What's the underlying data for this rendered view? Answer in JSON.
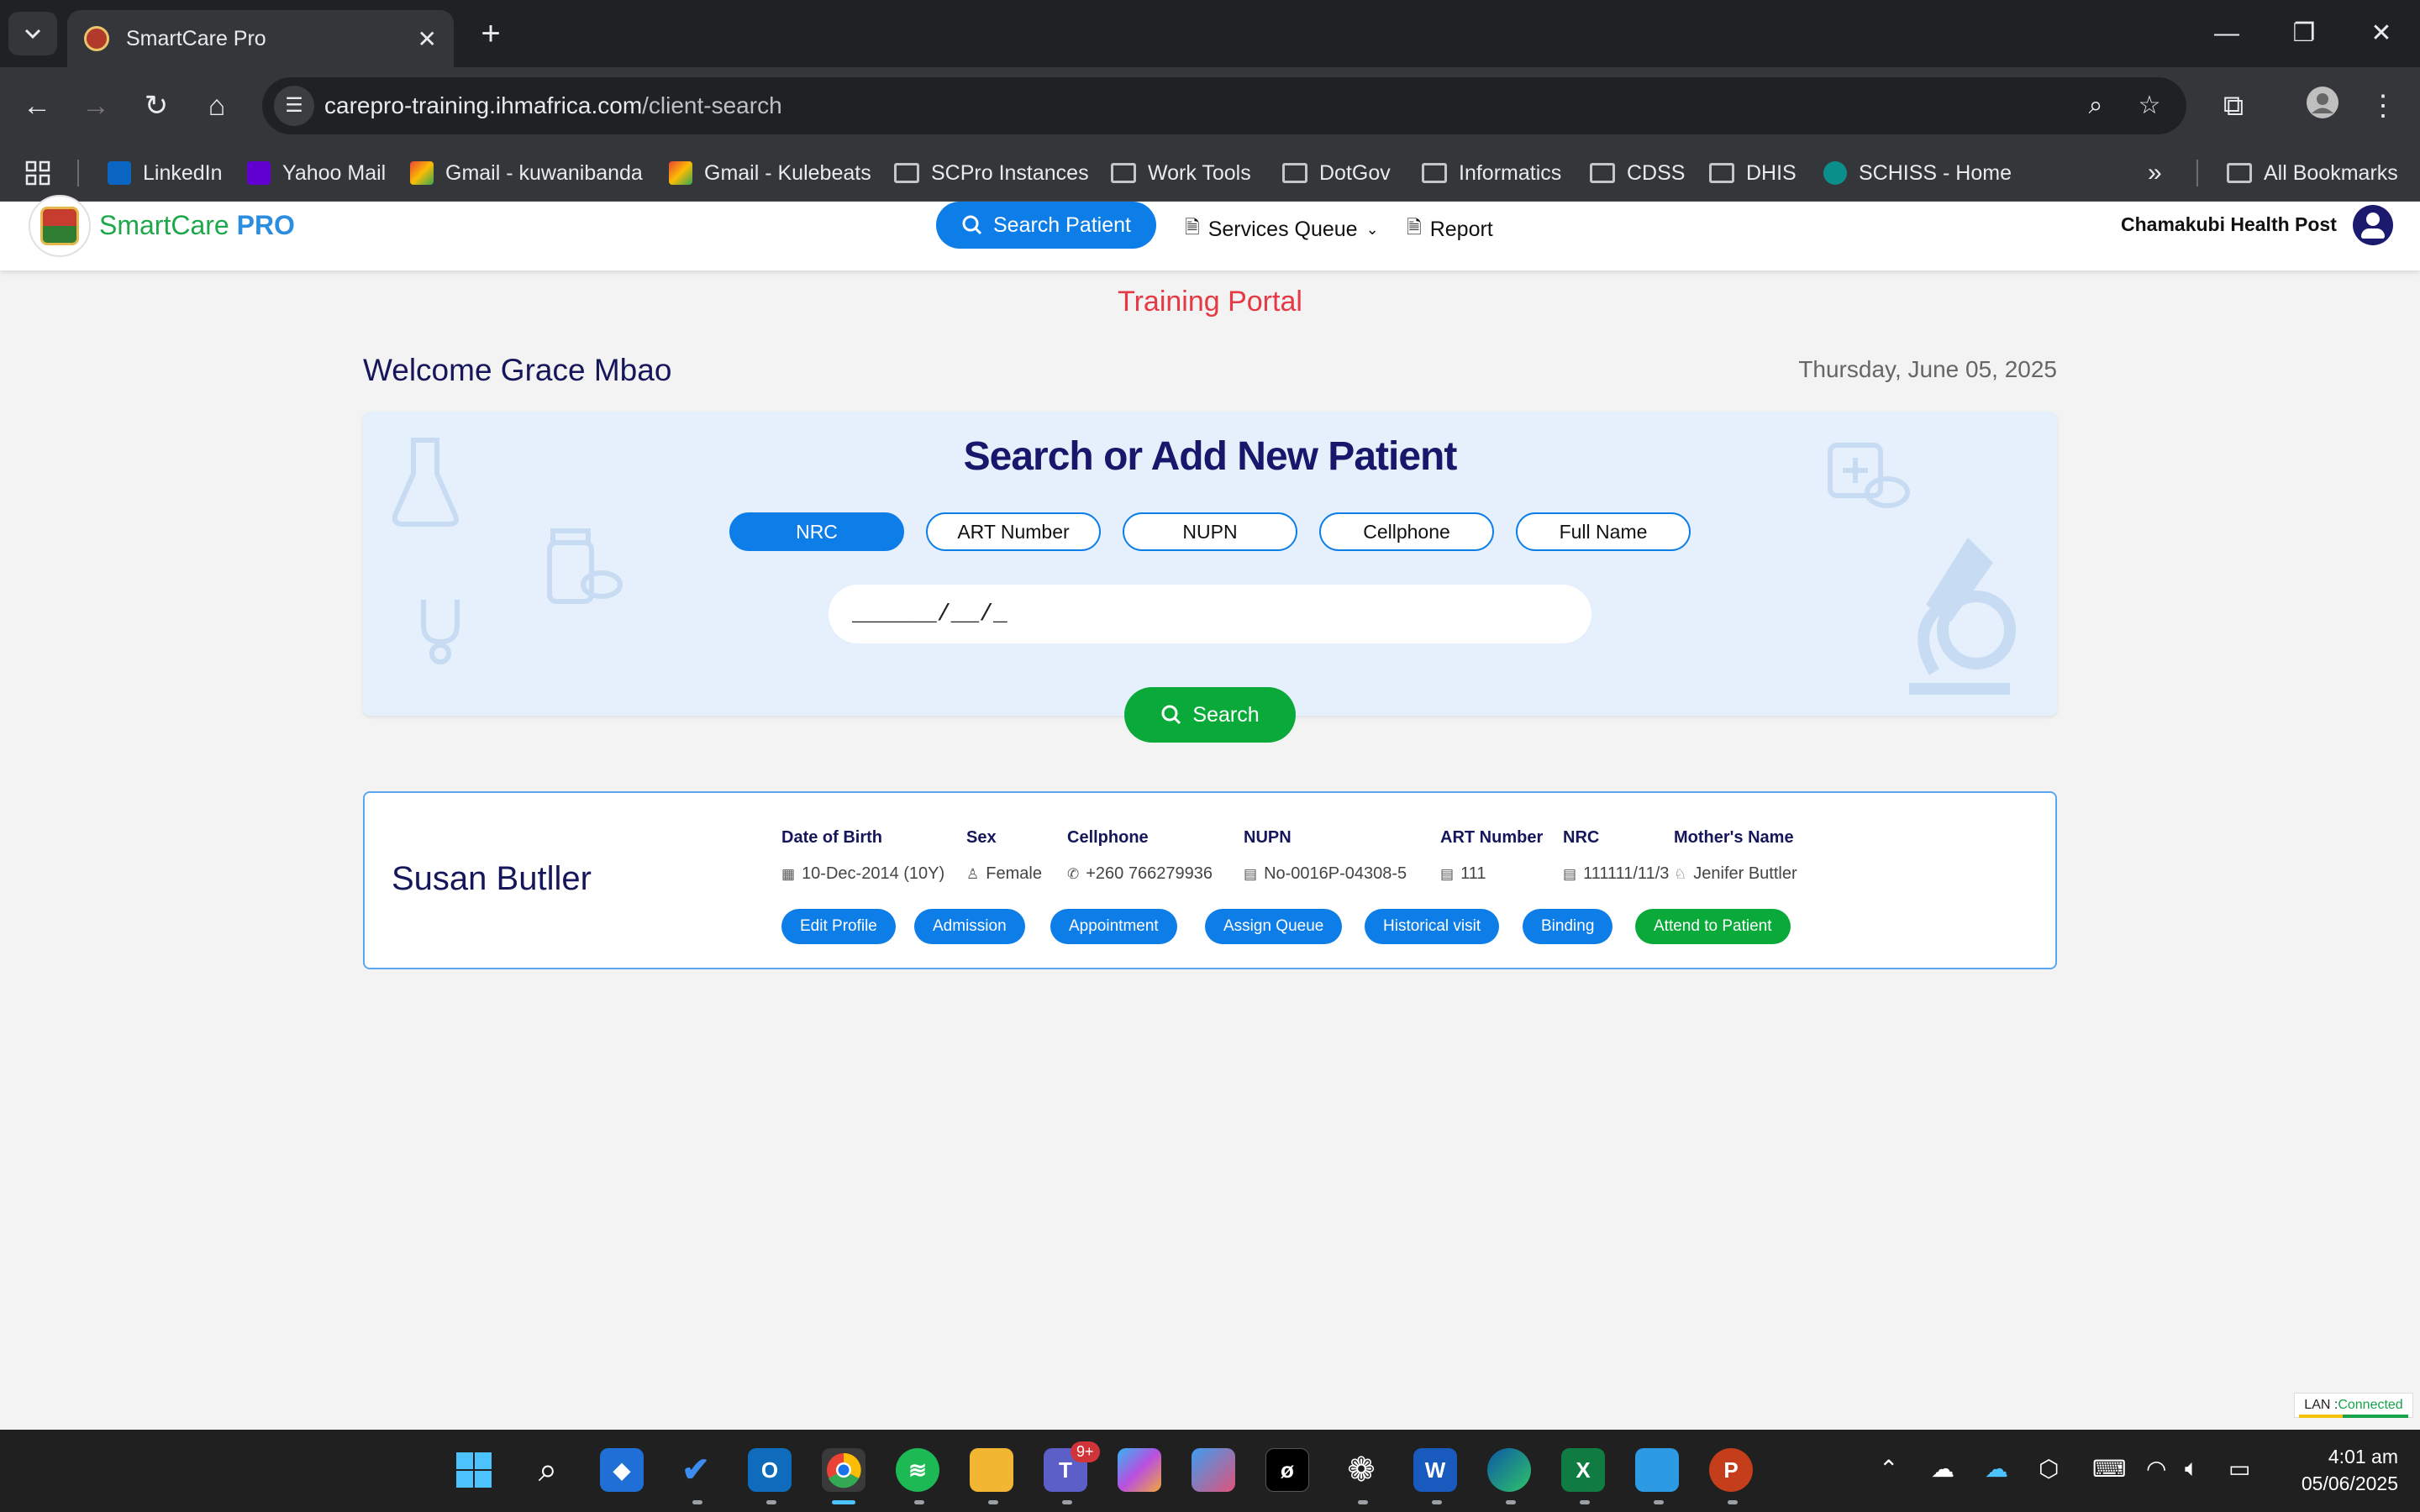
{
  "browser": {
    "tab_title": "SmartCare Pro",
    "url_host": "carepro-training.ihmafrica.com",
    "url_path": "/client-search",
    "bookmarks": [
      "LinkedIn",
      "Yahoo Mail",
      "Gmail - kuwanibanda",
      "Gmail - Kulebeats",
      "SCPro Instances",
      "Work Tools",
      "DotGov",
      "Informatics",
      "CDSS",
      "DHIS",
      "SCHISS - Home"
    ],
    "all_bookmarks": "All Bookmarks"
  },
  "header": {
    "brand_a": "SmartCare",
    "brand_b": "PRO",
    "search_patient": "Search Patient",
    "services_queue": "Services Queue",
    "report": "Report",
    "facility": "Chamakubi Health Post"
  },
  "page": {
    "training_banner": "Training Portal",
    "welcome": "Welcome Grace Mbao",
    "date": "Thursday, June 05, 2025"
  },
  "search": {
    "title": "Search or Add New Patient",
    "filters": [
      "NRC",
      "ART Number",
      "NUPN",
      "Cellphone",
      "Full Name"
    ],
    "active_filter": "NRC",
    "input_value": "______/__/_",
    "button": "Search"
  },
  "result": {
    "name": "Susan Butller",
    "fields": [
      {
        "label": "Date of Birth",
        "value": "10-Dec-2014 (10Y)",
        "icon": "calendar-icon"
      },
      {
        "label": "Sex",
        "value": "Female",
        "icon": "person-icon"
      },
      {
        "label": "Cellphone",
        "value": "+260 766279936",
        "icon": "phone-icon"
      },
      {
        "label": "NUPN",
        "value": "No-0016P-04308-5",
        "icon": "id-card-icon"
      },
      {
        "label": "ART Number",
        "value": "111",
        "icon": "id-card-icon"
      },
      {
        "label": "NRC",
        "value": "111111/11/3",
        "icon": "id-card-icon"
      },
      {
        "label": "Mother's Name",
        "value": "Jenifer Buttler",
        "icon": "mother-icon"
      }
    ],
    "actions": [
      "Edit Profile",
      "Admission",
      "Appointment",
      "Assign Queue",
      "Historical visit",
      "Binding",
      "Attend to Patient"
    ]
  },
  "status": {
    "lan_label": "LAN :",
    "lan_state": "Connected"
  },
  "taskbar": {
    "time": "4:01 am",
    "date": "05/06/2025",
    "teams_badge": "9+"
  },
  "colors": {
    "primary": "#0d7de8",
    "success": "#0aaa3a",
    "navy": "#16165a",
    "banner": "#e53945"
  }
}
